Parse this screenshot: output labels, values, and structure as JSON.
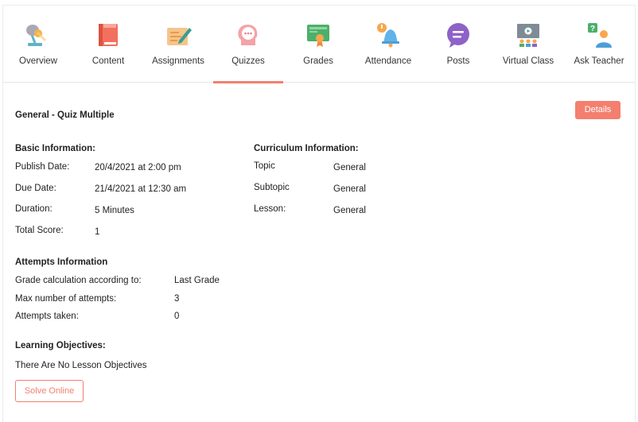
{
  "tabs": [
    {
      "label": "Overview",
      "icon": "desk-lamp-icon"
    },
    {
      "label": "Content",
      "icon": "book-icon"
    },
    {
      "label": "Assignments",
      "icon": "assignment-pencil-icon"
    },
    {
      "label": "Quizzes",
      "icon": "head-chat-icon",
      "active": true
    },
    {
      "label": "Grades",
      "icon": "certificate-icon"
    },
    {
      "label": "Attendance",
      "icon": "bell-icon"
    },
    {
      "label": "Posts",
      "icon": "speech-bubble-icon"
    },
    {
      "label": "Virtual Class",
      "icon": "video-class-icon"
    },
    {
      "label": "Ask Teacher",
      "icon": "ask-question-icon"
    }
  ],
  "quiz": {
    "title": "General - Quiz Multiple",
    "details_label": "Details"
  },
  "basic": {
    "heading": "Basic Information:",
    "publish_label": "Publish Date:",
    "publish_value": "20/4/2021 at 2:00 pm",
    "due_label": "Due Date:",
    "due_value": "21/4/2021 at 12:30 am",
    "duration_label": "Duration:",
    "duration_value": "5 Minutes",
    "score_label": "Total Score:",
    "score_value": "1"
  },
  "curriculum": {
    "heading": "Curriculum Information:",
    "topic_label": "Topic",
    "topic_value": "General",
    "subtopic_label": "Subtopic",
    "subtopic_value": "General",
    "lesson_label": "Lesson:",
    "lesson_value": "General"
  },
  "attempts": {
    "heading": "Attempts Information",
    "grade_calc_label": "Grade calculation according to:",
    "grade_calc_value": "Last Grade",
    "max_label": "Max number of attempts:",
    "max_value": "3",
    "taken_label": "Attempts taken:",
    "taken_value": "0"
  },
  "objectives": {
    "heading": "Learning Objectives:",
    "text": "There Are No Lesson Objectives"
  },
  "solve_label": "Solve Online",
  "colors": {
    "accent": "#f37f6f"
  }
}
